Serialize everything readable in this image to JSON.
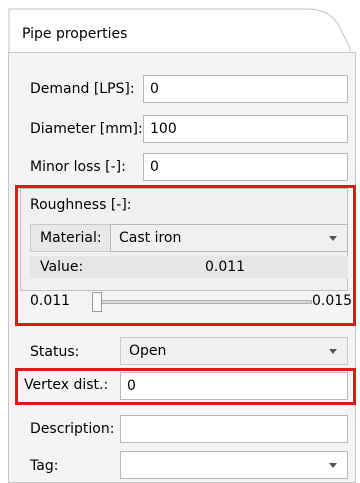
{
  "panel": {
    "tab_title": "Pipe properties"
  },
  "fields": {
    "demand": {
      "label": "Demand [LPS]:",
      "value": "0"
    },
    "diameter": {
      "label": "Diameter [mm]:",
      "value": "100"
    },
    "minor_loss": {
      "label": "Minor loss [-]:",
      "value": "0"
    }
  },
  "roughness": {
    "title": "Roughness [-]:",
    "material_label": "Material:",
    "material_value": "Cast iron",
    "value_label": "Value:",
    "value": "0.011",
    "slider_min": "0.011",
    "slider_max": "0.015"
  },
  "status": {
    "label": "Status:",
    "value": "Open"
  },
  "vertex_dist": {
    "label": "Vertex dist.:",
    "value": "0"
  },
  "description": {
    "label": "Description:",
    "value": ""
  },
  "tag": {
    "label": "Tag:",
    "value": ""
  },
  "highlight_color": "#e01818"
}
